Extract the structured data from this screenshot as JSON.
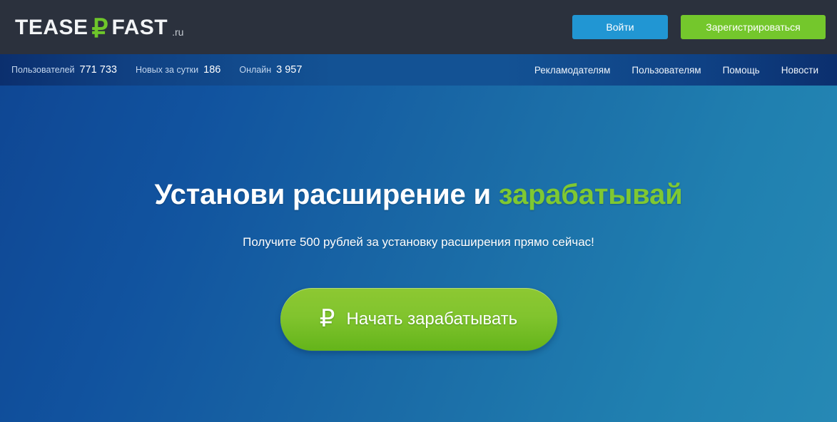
{
  "header": {
    "logo": {
      "word_left": "TEASE",
      "ruble_symbol": "₽",
      "word_right": "FAST",
      "tld": ".ru"
    },
    "login_label": "Войти",
    "register_label": "Зарегистрироваться"
  },
  "statsbar": {
    "stats": [
      {
        "label": "Пользователей",
        "value": "771 733"
      },
      {
        "label": "Новых за сутки",
        "value": "186"
      },
      {
        "label": "Онлайн",
        "value": "3 957"
      }
    ],
    "nav": [
      {
        "label": "Рекламодателям"
      },
      {
        "label": "Пользователям"
      },
      {
        "label": "Помощь"
      },
      {
        "label": "Новости"
      }
    ]
  },
  "hero": {
    "title_main": "Установи расширение и ",
    "title_accent": "зарабатывай",
    "subtitle": "Получите 500 рублей за установку расширения прямо сейчас!",
    "cta_ruble_symbol": "₽",
    "cta_label": "Начать зарабатывать"
  },
  "colors": {
    "header_bg": "#2b313d",
    "accent_green": "#74c72c",
    "accent_blue": "#2196d3",
    "hero_blue_dark": "#0f4794",
    "hero_blue_light": "#2689b5",
    "title_accent": "#7fc832"
  }
}
